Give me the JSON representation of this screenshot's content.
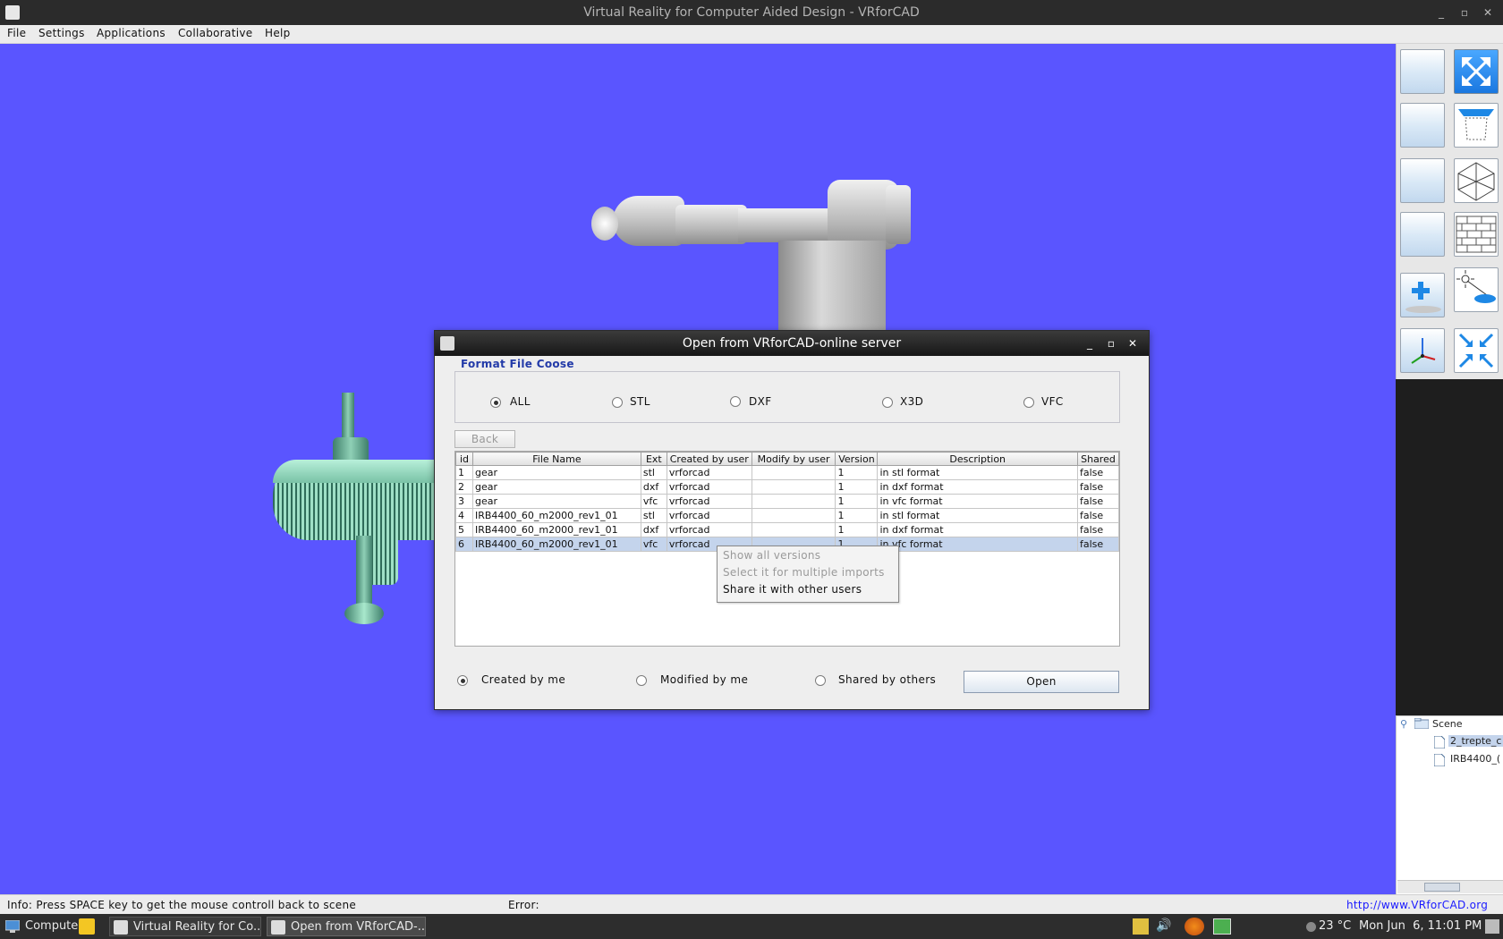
{
  "window": {
    "title": "Virtual Reality for Computer Aided Design - VRforCAD",
    "minimize": "_",
    "maximize": "▫",
    "close": "✕"
  },
  "menu": [
    "File",
    "Settings",
    "Applications",
    "Collaborative",
    "Help"
  ],
  "dialog": {
    "title": "Open from VRforCAD-online server",
    "format_legend": "Format File Coose",
    "formats": [
      "ALL",
      "STL",
      "DXF",
      "X3D",
      "VFC"
    ],
    "selected_format": "ALL",
    "back_label": "Back",
    "columns": [
      "id",
      "File Name",
      "Ext",
      "Created by user",
      "Modify by user",
      "Version",
      "Description",
      "Shared"
    ],
    "rows": [
      [
        "1",
        "gear",
        "stl",
        "vrforcad",
        "",
        "1",
        "in stl format",
        "false"
      ],
      [
        "2",
        "gear",
        "dxf",
        "vrforcad",
        "",
        "1",
        "in dxf format",
        "false"
      ],
      [
        "3",
        "gear",
        "vfc",
        "vrforcad",
        "",
        "1",
        "in vfc format",
        "false"
      ],
      [
        "4",
        "IRB4400_60_m2000_rev1_01",
        "stl",
        "vrforcad",
        "",
        "1",
        "in stl format",
        "false"
      ],
      [
        "5",
        "IRB4400_60_m2000_rev1_01",
        "dxf",
        "vrforcad",
        "",
        "1",
        "in dxf format",
        "false"
      ],
      [
        "6",
        "IRB4400_60_m2000_rev1_01",
        "vfc",
        "vrforcad",
        "",
        "1",
        "in vfc format",
        "false"
      ]
    ],
    "selected_row": 6,
    "context_menu": [
      "Show all versions",
      "Select it for multiple imports",
      "Share it with other users"
    ],
    "filters": [
      "Created by me",
      "Modified by me",
      "Shared by others"
    ],
    "selected_filter": "Created by me",
    "open_label": "Open"
  },
  "scene_tree": {
    "root": "Scene",
    "children": [
      "2_trepte_c",
      "IRB4400_("
    ]
  },
  "status": {
    "info": "Info: Press SPACE key to get the mouse controll back to scene",
    "error": "Error:",
    "url": "http://www.VRforCAD.org"
  },
  "taskbar": {
    "items": [
      "Computer",
      "Virtual Reality for Co...",
      "Open from VRforCAD-..."
    ],
    "temperature": "23 °C",
    "clock": "Mon Jun  6, 11:01 PM"
  },
  "colors": {
    "viewport": "#5a55ff",
    "selection": "#c4d4ec",
    "legend": "#223aa8",
    "link": "#1a1aff"
  }
}
